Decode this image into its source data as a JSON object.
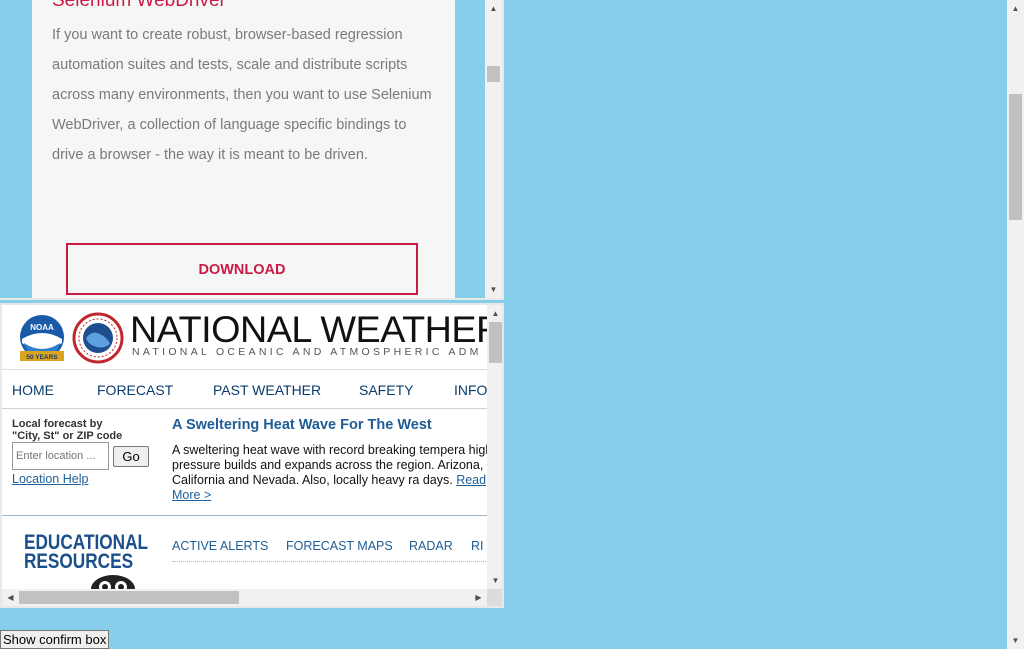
{
  "frame1": {
    "card_title": "Selenium WebDriver",
    "card_text": "If you want to create robust, browser-based regression automation suites and tests, scale and distribute scripts across many environments, then you want to use Selenium WebDriver, a collection of language specific bindings to drive a browser - the way it is meant to be driven.",
    "download_label": "DOWNLOAD"
  },
  "frame2": {
    "site_title": "NATIONAL WEATHER",
    "site_subtitle": "NATIONAL OCEANIC AND ATMOSPHERIC ADM",
    "noaa_badge": "NOAA",
    "noaa_years": "50 YEARS",
    "nav": [
      "HOME",
      "FORECAST",
      "PAST WEATHER",
      "SAFETY",
      "INFO"
    ],
    "local_forecast_label_1": "Local forecast by",
    "local_forecast_label_2": "\"City, St\" or ZIP code",
    "location_placeholder": "Enter location ...",
    "go_label": "Go",
    "location_help": "Location Help",
    "news_title": "A Sweltering Heat Wave For The West",
    "news_body": "A sweltering heat wave with record breaking tempera high pressure builds and expands across the region. Arizona, California and Nevada. Also, locally heavy ra days.",
    "read_more": "Read More >",
    "educational_1": "EDUCATIONAL",
    "educational_2": "RESOURCES",
    "subnav": [
      "ACTIVE ALERTS",
      "FORECAST MAPS",
      "RADAR",
      "RI"
    ]
  },
  "confirm_button_label": "Show confirm box",
  "colors": {
    "page_background": "#87ceeb",
    "accent_red": "#cb1b45",
    "nws_blue": "#1e5d95"
  }
}
